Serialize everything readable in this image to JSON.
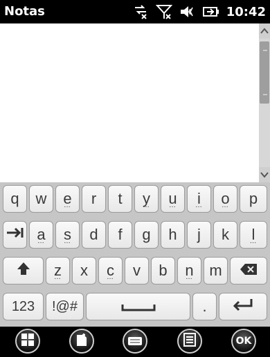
{
  "status": {
    "title": "Notas",
    "time": "10:42",
    "icons": [
      "data-connection-icon",
      "signal-off-icon",
      "speaker-icon",
      "battery-charging-icon"
    ]
  },
  "keyboard": {
    "row1": [
      "q",
      "w",
      "e",
      "r",
      "t",
      "y",
      "u",
      "i",
      "o",
      "p"
    ],
    "row2": [
      "a",
      "s",
      "d",
      "f",
      "g",
      "h",
      "j",
      "k",
      "l"
    ],
    "row3": [
      "z",
      "x",
      "c",
      "v",
      "b",
      "n",
      "m"
    ],
    "bottom": {
      "numbers": "123",
      "symbols": "!@#",
      "period": "."
    }
  },
  "bottom_bar": {
    "ok_label": "OK"
  }
}
